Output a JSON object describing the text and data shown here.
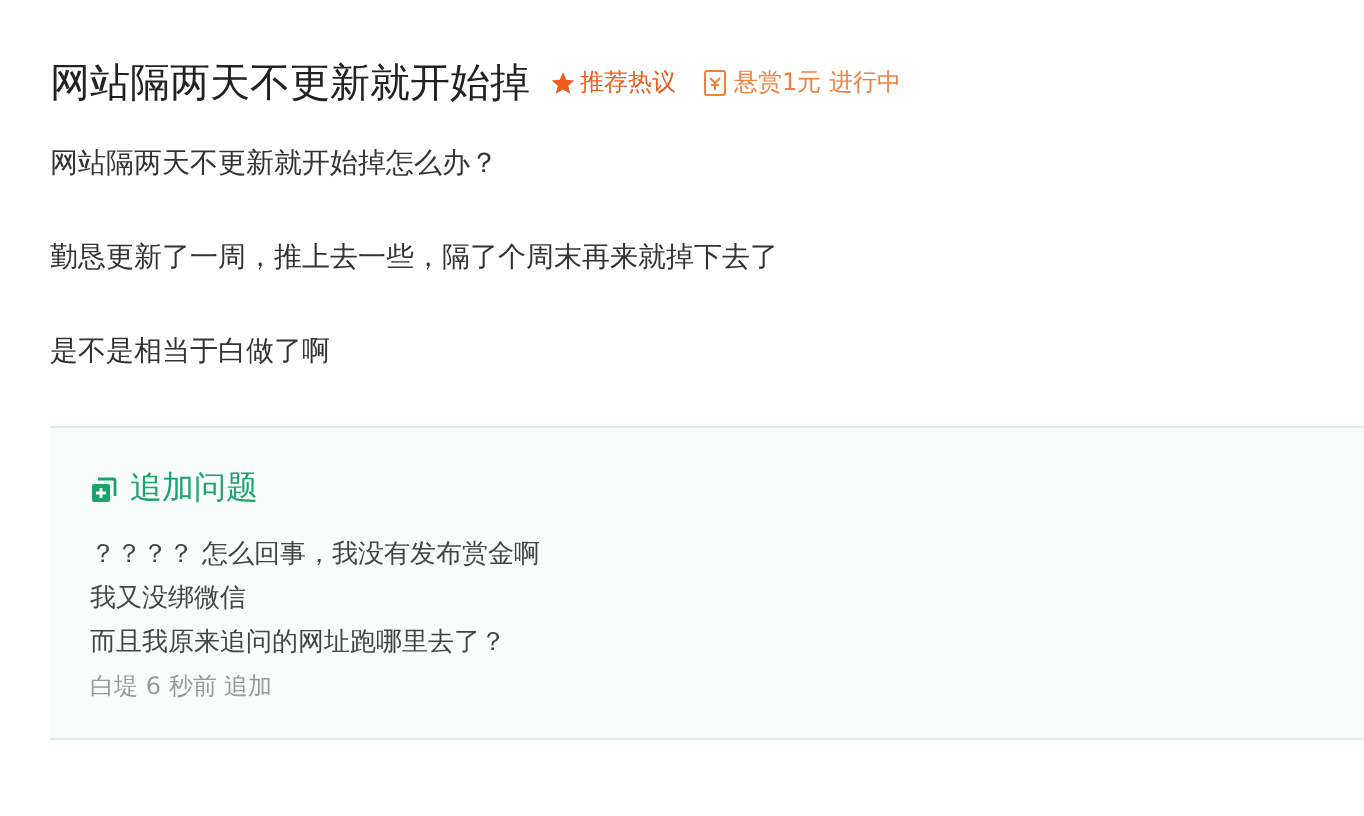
{
  "question": {
    "title": "网站隔两天不更新就开始掉",
    "badges": [
      {
        "kind": "recommend",
        "text": "推荐热议"
      },
      {
        "kind": "bounty",
        "text": "悬赏1元 进行中"
      }
    ],
    "paragraphs": [
      "网站隔两天不更新就开始掉怎么办？",
      "勤恳更新了一周，推上去一些，隔了个周末再来就掉下去了",
      "是不是相当于白做了啊"
    ]
  },
  "supplement": {
    "heading": "追加问题",
    "lines": [
      "？？？？ 怎么回事，我没有发布赏金啊",
      "我又没绑微信",
      "而且我原来追问的网址跑哪里去了？"
    ],
    "meta": "白堤 6 秒前 追加"
  }
}
